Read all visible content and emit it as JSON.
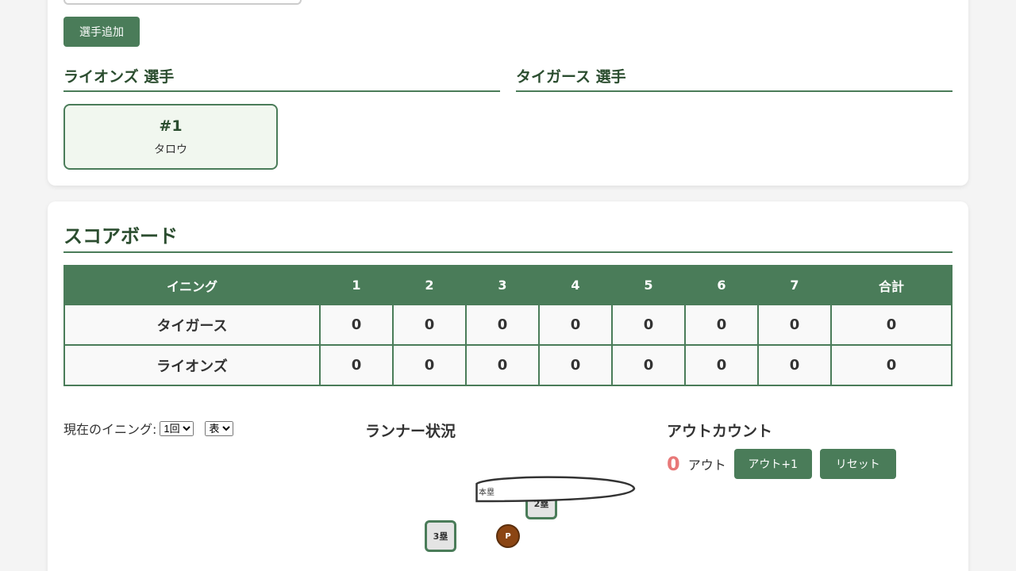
{
  "player_form": {
    "add_button": "選手追加"
  },
  "teams": {
    "lions": {
      "heading": "ライオンズ 選手",
      "players": [
        {
          "number": "#1",
          "name": "タロウ"
        }
      ]
    },
    "tigers": {
      "heading": "タイガース 選手",
      "players": []
    }
  },
  "scoreboard": {
    "title": "スコアボード",
    "headers": [
      "イニング",
      "1",
      "2",
      "3",
      "4",
      "5",
      "6",
      "7",
      "合計"
    ],
    "rows": [
      {
        "team": "タイガース",
        "scores": [
          "0",
          "0",
          "0",
          "0",
          "0",
          "0",
          "0"
        ],
        "total": "0"
      },
      {
        "team": "ライオンズ",
        "scores": [
          "0",
          "0",
          "0",
          "0",
          "0",
          "0",
          "0"
        ],
        "total": "0"
      }
    ]
  },
  "inning": {
    "label": "現在のイニング:",
    "selected_inning": "1回",
    "selected_half": "表"
  },
  "runners": {
    "title": "ランナー状況",
    "second_base": "2塁",
    "third_base": "3塁",
    "home": "本塁",
    "pitcher": "P"
  },
  "outs": {
    "title": "アウトカウント",
    "count": "0",
    "unit": "アウト",
    "plus_button": "アウト+1",
    "reset_button": "リセット"
  },
  "colors": {
    "accent": "#4a7c59",
    "heading": "#2b4d2f",
    "out_count": "#e87878",
    "pitcher": "#8b4513"
  }
}
